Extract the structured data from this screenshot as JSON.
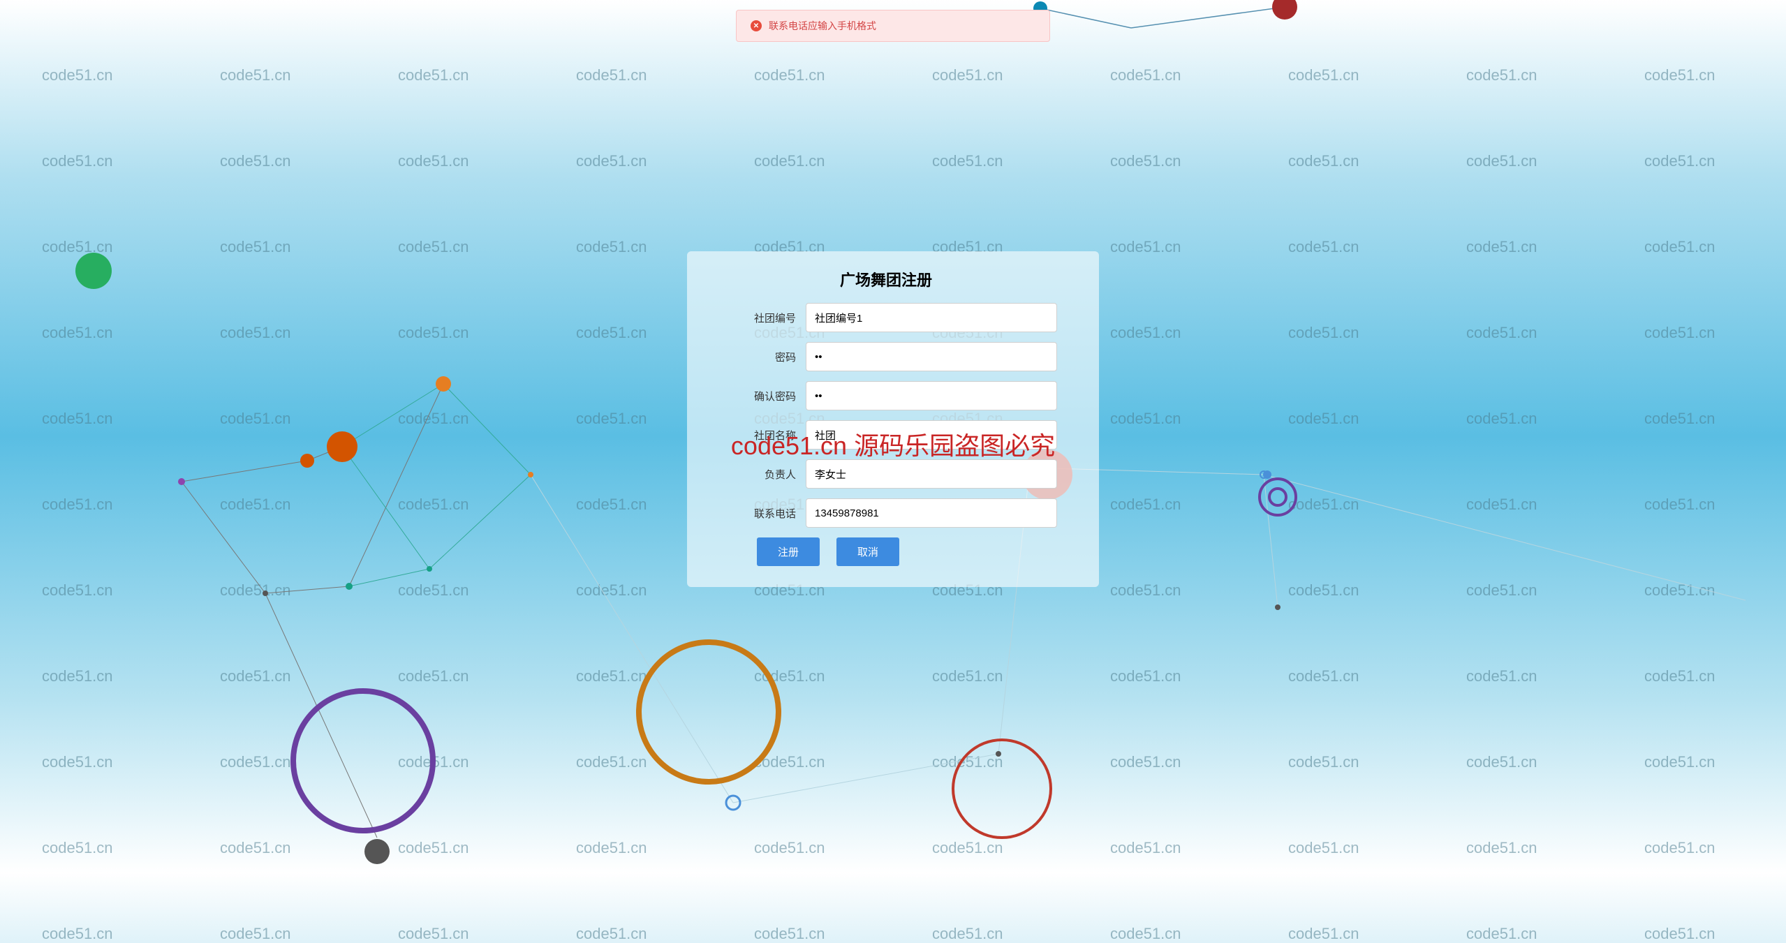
{
  "watermark_text": "code51.cn",
  "error": {
    "message": "联系电话应输入手机格式"
  },
  "form": {
    "title": "广场舞团注册",
    "fields": {
      "club_id": {
        "label": "社团编号",
        "value": "社团编号1"
      },
      "password": {
        "label": "密码",
        "value": "••"
      },
      "confirm_password": {
        "label": "确认密码",
        "value": "••"
      },
      "club_name": {
        "label": "社团名称",
        "value": "社团"
      },
      "leader": {
        "label": "负责人",
        "value": "李女士"
      },
      "phone": {
        "label": "联系电话",
        "value": "13459878981"
      }
    },
    "buttons": {
      "submit": "注册",
      "cancel": "取消"
    }
  },
  "center_watermark": "code51.cn 源码乐园盗图必究"
}
